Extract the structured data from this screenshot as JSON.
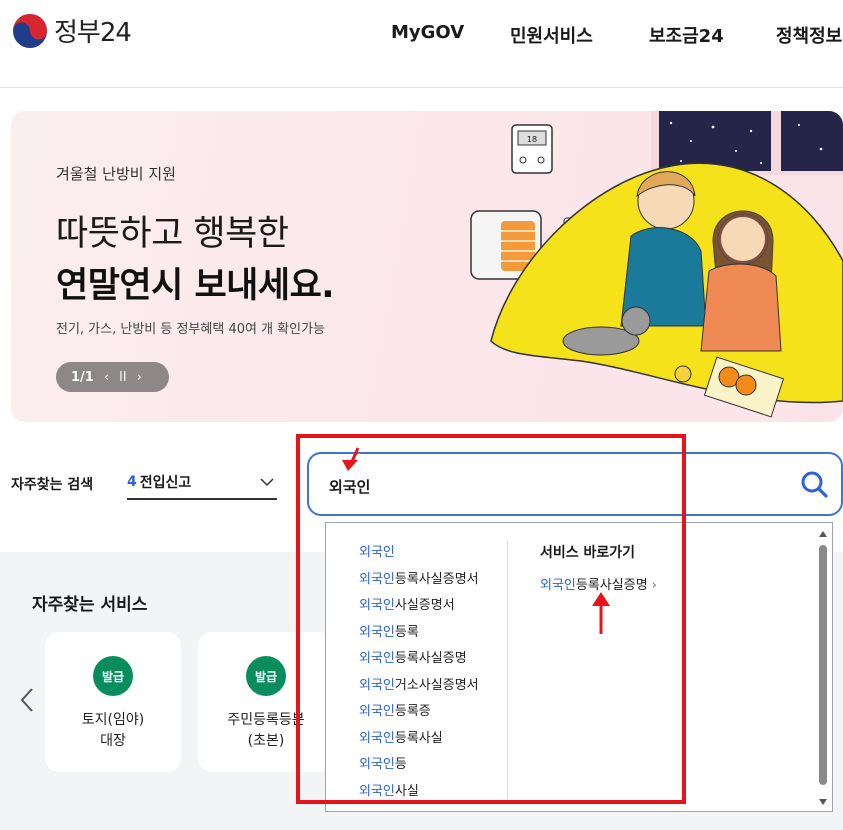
{
  "header": {
    "logo_text": "정부24",
    "nav": [
      "MyGOV",
      "민원서비스",
      "보조금24",
      "정책정보"
    ]
  },
  "banner": {
    "subtitle": "겨울철 난방비 지원",
    "headline_line1": "따뜻하고 행복한",
    "headline_line2": "연말연시 보내세요.",
    "description": "전기, 가스, 난방비 등 정부혜택 40여 개 확인가능",
    "pager": "1/1",
    "thermostat_reading": "18"
  },
  "search": {
    "faq_label": "자주찾는 검색",
    "faq_rank": "4",
    "faq_value": "전입신고",
    "query": "외국인",
    "suggestions": [
      {
        "hl": "외국인",
        "rest": ""
      },
      {
        "hl": "외국인",
        "rest": "등록사실증명서"
      },
      {
        "hl": "외국인",
        "rest": "사실증명서"
      },
      {
        "hl": "외국인",
        "rest": "등록"
      },
      {
        "hl": "외국인",
        "rest": "등록사실증명"
      },
      {
        "hl": "외국인",
        "rest": "거소사실증명서"
      },
      {
        "hl": "외국인",
        "rest": "등록증"
      },
      {
        "hl": "외국인",
        "rest": "등록사실"
      },
      {
        "hl": "외국인",
        "rest": "등"
      },
      {
        "hl": "외국인",
        "rest": "사실"
      }
    ],
    "shortcut_title": "서비스 바로가기",
    "shortcut_hl": "외국인",
    "shortcut_rest": "등록사실증명",
    "shortcut_arrow": "›"
  },
  "services": {
    "title": "자주찾는 서비스",
    "cards": [
      {
        "badge": "발급",
        "line1": "토지(임야)",
        "line2": "대장"
      },
      {
        "badge": "발급",
        "line1": "주민등록등본",
        "line2": "(초본)"
      }
    ]
  },
  "colors": {
    "accent_blue": "#2b62d9",
    "badge_green": "#0a8d5c",
    "annotation_red": "#e8141b"
  }
}
